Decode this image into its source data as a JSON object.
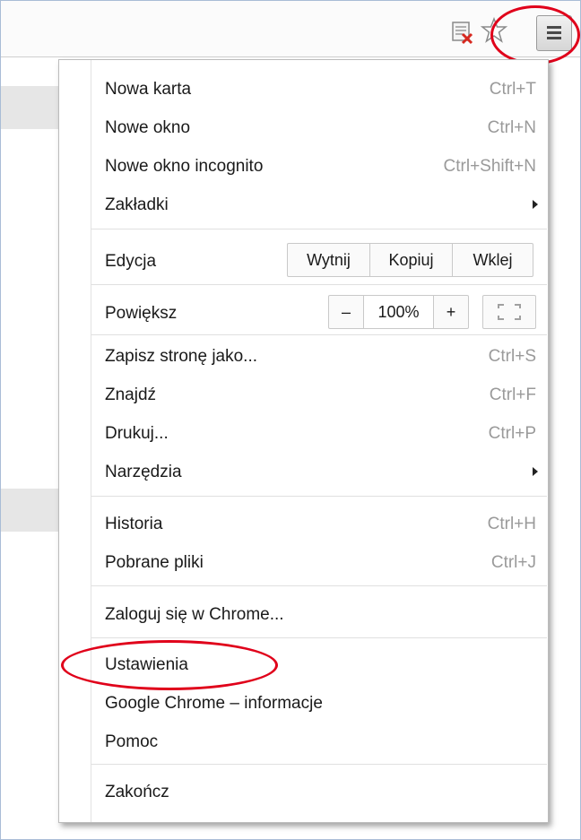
{
  "toolbar": {
    "icons": [
      "page-cancel-icon",
      "star-bookmark-icon",
      "hamburger-menu-icon"
    ]
  },
  "menu": {
    "new_tab": {
      "label": "Nowa karta",
      "shortcut": "Ctrl+T"
    },
    "new_window": {
      "label": "Nowe okno",
      "shortcut": "Ctrl+N"
    },
    "incognito": {
      "label": "Nowe okno incognito",
      "shortcut": "Ctrl+Shift+N"
    },
    "bookmarks": {
      "label": "Zakładki"
    },
    "edit": {
      "label": "Edycja",
      "cut": "Wytnij",
      "copy": "Kopiuj",
      "paste": "Wklej"
    },
    "zoom": {
      "label": "Powiększ",
      "minus": "–",
      "value": "100%",
      "plus": "+"
    },
    "save_page": {
      "label": "Zapisz stronę jako...",
      "shortcut": "Ctrl+S"
    },
    "find": {
      "label": "Znajdź",
      "shortcut": "Ctrl+F"
    },
    "print": {
      "label": "Drukuj...",
      "shortcut": "Ctrl+P"
    },
    "tools": {
      "label": "Narzędzia"
    },
    "history": {
      "label": "Historia",
      "shortcut": "Ctrl+H"
    },
    "downloads": {
      "label": "Pobrane pliki",
      "shortcut": "Ctrl+J"
    },
    "sign_in": {
      "label": "Zaloguj się w Chrome..."
    },
    "settings": {
      "label": "Ustawienia"
    },
    "about": {
      "label": "Google Chrome – informacje"
    },
    "help": {
      "label": "Pomoc"
    },
    "exit": {
      "label": "Zakończ"
    }
  },
  "colors": {
    "highlight_ring": "#e0001a",
    "page_border": "#a9bcd6"
  }
}
